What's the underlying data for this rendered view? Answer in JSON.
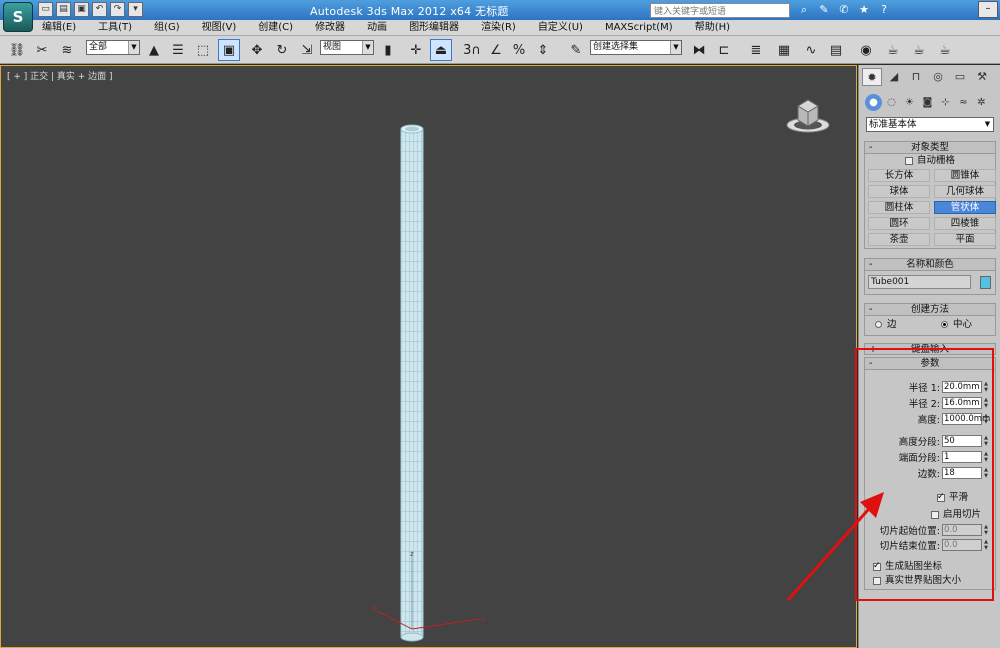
{
  "titlebar": {
    "app_logo": "S",
    "title": "Autodesk 3ds Max  2012 x64       无标题",
    "search_placeholder": "键入关键字或短语",
    "help_label": "?"
  },
  "menubar": {
    "items": [
      "编辑(E)",
      "工具(T)",
      "组(G)",
      "视图(V)",
      "创建(C)",
      "修改器",
      "动画",
      "图形编辑器",
      "渲染(R)",
      "自定义(U)",
      "MAXScript(M)",
      "帮助(H)"
    ]
  },
  "toolbar": {
    "selection_filter": "全部",
    "ref_coord": "视图",
    "named_selection": "创建选择集",
    "snap_label": "3"
  },
  "viewport": {
    "label": "[ + ] 正交 | 真实 + 边面 ]"
  },
  "command_panel": {
    "category_dropdown": "标准基本体",
    "object_type": {
      "title": "对象类型",
      "autogrid_label": "自动栅格",
      "buttons": [
        "长方体",
        "圆锥体",
        "球体",
        "几何球体",
        "圆柱体",
        "管状体",
        "圆环",
        "四棱锥",
        "茶壶",
        "平面"
      ],
      "active": "管状体"
    },
    "name_color": {
      "title": "名称和颜色",
      "name": "Tube001",
      "color": "#50c3e0"
    },
    "creation_method": {
      "title": "创建方法",
      "option_edge": "边",
      "option_center": "中心",
      "selected": "中心"
    },
    "keyboard_entry": {
      "title": "键盘输入"
    },
    "parameters": {
      "title": "参数",
      "radius1_label": "半径 1:",
      "radius1": "20.0mm",
      "radius2_label": "半径 2:",
      "radius2": "16.0mm",
      "height_label": "高度:",
      "height": "1000.0mm",
      "height_segs_label": "高度分段:",
      "height_segs": "50",
      "cap_segs_label": "端面分段:",
      "cap_segs": "1",
      "sides_label": "边数:",
      "sides": "18",
      "smooth_label": "平滑",
      "slice_on_label": "启用切片",
      "slice_from_label": "切片起始位置:",
      "slice_from": "0.0",
      "slice_to_label": "切片结束位置:",
      "slice_to": "0.0",
      "gen_mapping_label": "生成贴图坐标",
      "real_world_label": "真实世界贴图大小"
    }
  },
  "colors": {
    "viewport_bg": "#434343",
    "active_button": "#4b87d8",
    "highlight_annotation": "#e01010",
    "viewport_border": "#d9a93c"
  }
}
